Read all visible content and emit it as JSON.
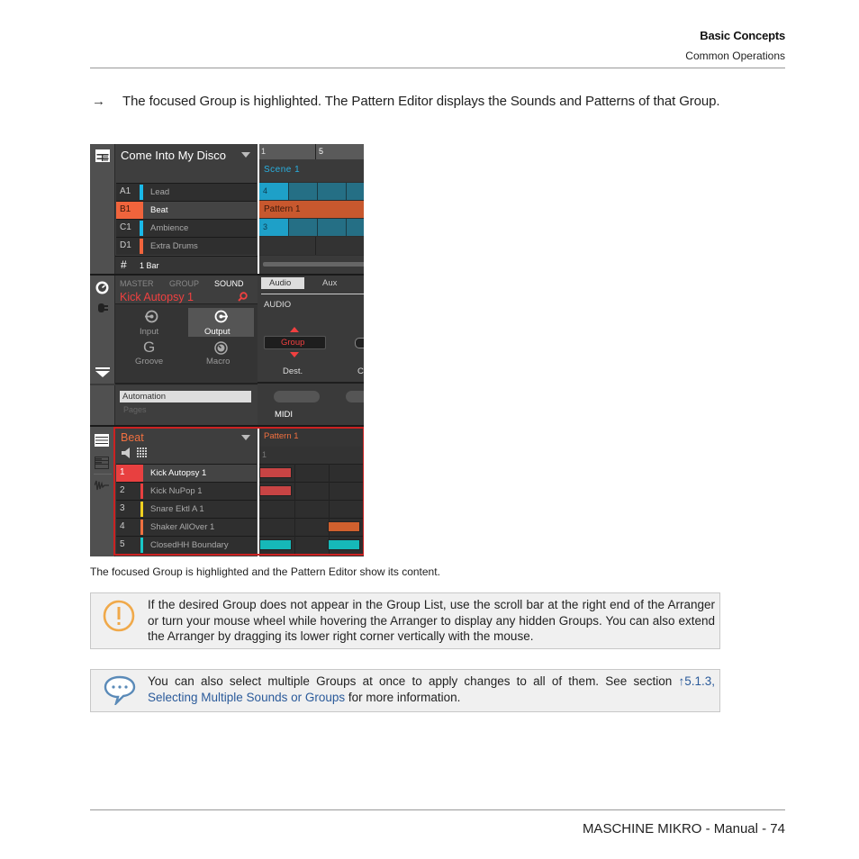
{
  "header": {
    "chapter": "Basic Concepts",
    "section": "Common Operations"
  },
  "body": {
    "arrow": "→",
    "bullet": "The focused Group is highlighted. The Pattern Editor displays the Sounds and Patterns of that Group.",
    "caption": "The focused Group is highlighted and the Pattern Editor show its content."
  },
  "screenshot": {
    "project_name": "Come Into My Disco",
    "groups": [
      {
        "id": "A1",
        "name": "Lead",
        "color": "#1ab8e8",
        "selected": false
      },
      {
        "id": "B1",
        "name": "Beat",
        "color": "#f0643c",
        "selected": true
      },
      {
        "id": "C1",
        "name": "Ambience",
        "color": "#1ab8e8",
        "selected": false
      },
      {
        "id": "D1",
        "name": "Extra Drums",
        "color": "#f0643c",
        "selected": false
      }
    ],
    "arranger": {
      "ruler": [
        "1",
        "5"
      ],
      "scene": "Scene 1",
      "clips": [
        "4",
        "Pattern 1",
        "3",
        ""
      ],
      "length": "1 Bar"
    },
    "control": {
      "tabs": [
        "MASTER",
        "GROUP",
        "SOUND"
      ],
      "active_tab": "SOUND",
      "sound_name": "Kick Autopsy 1",
      "pages": [
        "Input",
        "Output",
        "Groove",
        "Macro"
      ],
      "active_page": "Output",
      "param_tabs": [
        "Audio",
        "Aux"
      ],
      "section_label": "AUDIO",
      "dest_value": "Group",
      "dest_label": "Dest.",
      "next_label_partial": "C",
      "automation": "Automation",
      "pages_label": "Pages",
      "midi_label": "MIDI"
    },
    "pattern_editor": {
      "group_name": "Beat",
      "pattern_name": "Pattern 1",
      "ruler": "1",
      "sounds": [
        {
          "num": "1",
          "name": "Kick Autopsy 1",
          "color": "#e84040",
          "selected": true
        },
        {
          "num": "2",
          "name": "Kick NuPop 1",
          "color": "#e84040",
          "selected": false
        },
        {
          "num": "3",
          "name": "Snare Ektl A 1",
          "color": "#f0d020",
          "selected": false
        },
        {
          "num": "4",
          "name": "Shaker AllOver 1",
          "color": "#f07040",
          "selected": false
        },
        {
          "num": "5",
          "name": "ClosedHH Boundary",
          "color": "#18c8c8",
          "selected": false
        }
      ]
    }
  },
  "notes": [
    {
      "icon": "warning-icon",
      "text": "If the desired Group does not appear in the Group List, use the scroll bar at the right end of the Arranger or turn your mouse wheel while hovering the Arranger to display any hidden Groups. You can also extend the Arranger by dragging its lower right corner vertically with the mouse."
    },
    {
      "icon": "speech-bubble-icon",
      "text_before": "You can also select multiple Groups at once to apply changes to all of them. See section ",
      "link_ref": "↑5.1.3,",
      "link_text": "Selecting Multiple Sounds or Groups",
      "text_after": " for more information."
    }
  ],
  "footer": {
    "text": "MASCHINE MIKRO - Manual - 74"
  }
}
